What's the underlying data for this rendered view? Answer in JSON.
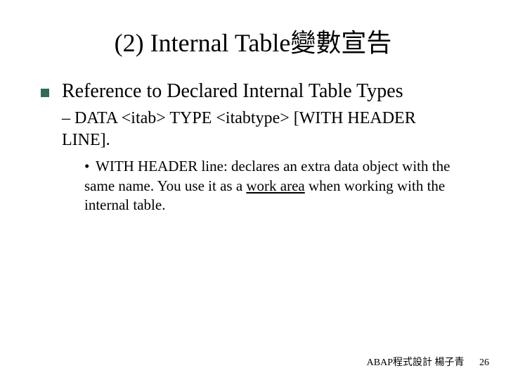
{
  "title": "(2) Internal Table變數宣告",
  "bullet1": "Reference to Declared Internal Table Types",
  "syntax_prefix": "– ",
  "syntax_text": "DATA <itab> TYPE <itabtype> [WITH HEADER LINE].",
  "sub_prefix": "• ",
  "sub_pre": "WITH HEADER line: declares an extra data object with the same name. You use it as a ",
  "sub_underlined": "work area",
  "sub_post": " when working with the internal table.",
  "footer_text": "ABAP程式設計 楊子青",
  "page_number": "26"
}
